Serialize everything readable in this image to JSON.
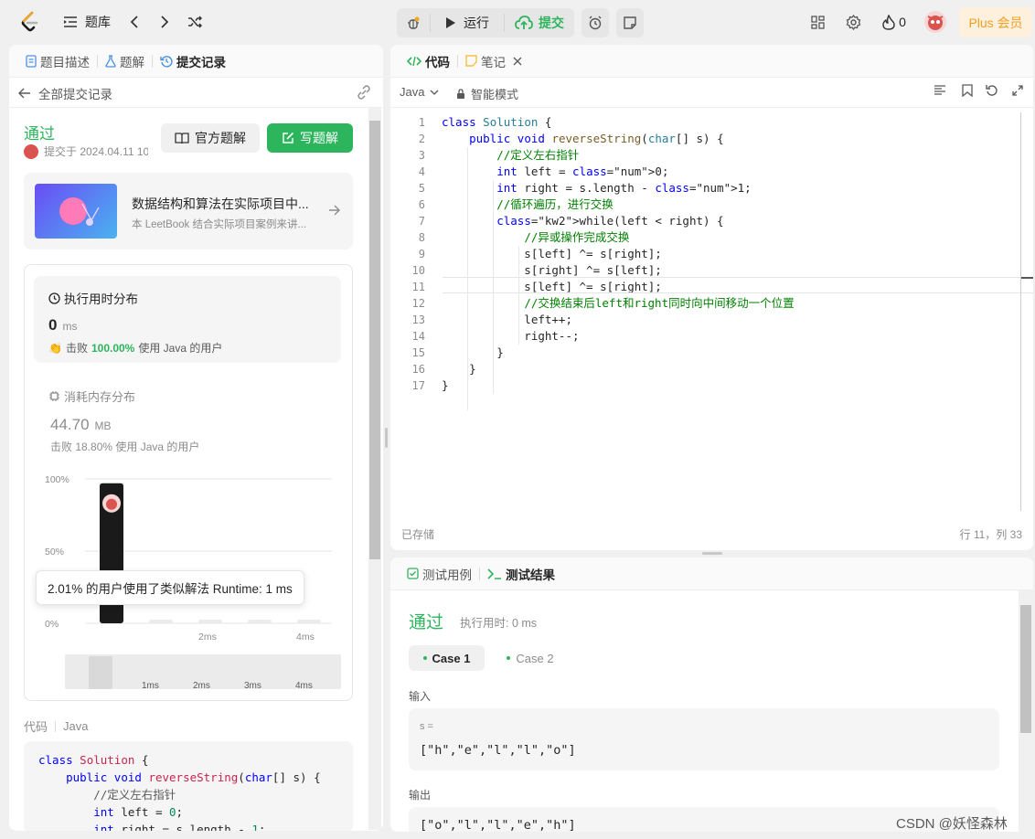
{
  "topbar": {
    "problems_label": "题库",
    "run_label": "运行",
    "submit_label": "提交",
    "streak_count": "0",
    "plus_label": "Plus 会员"
  },
  "left": {
    "tabs": [
      "题目描述",
      "题解",
      "提交记录"
    ],
    "back_label": "全部提交记录",
    "status": "通过",
    "submitted_at": "提交于 2024.04.11 10",
    "official_solution_label": "官方题解",
    "write_solution_label": "写题解",
    "promo": {
      "title": "数据结构和算法在实际项目中...",
      "subtitle": "本 LeetBook 结合实际项目案例来讲..."
    },
    "runtime": {
      "title": "执行用时分布",
      "value": "0",
      "unit": "ms",
      "beats_prefix": "击败",
      "beats_percent": "100.00%",
      "beats_suffix": "使用 Java 的用户"
    },
    "memory": {
      "title": "消耗内存分布",
      "value": "44.70",
      "unit": "MB",
      "beats_text": "击败 18.80% 使用 Java 的用户"
    },
    "tooltip": "2.01% 的用户使用了类似解法 Runtime: 1 ms",
    "code_label": "代码",
    "code_lang": "Java"
  },
  "chart_data": {
    "type": "bar",
    "categories": [
      "0ms",
      "1ms",
      "2ms",
      "3ms",
      "4ms"
    ],
    "values": [
      97,
      1,
      1,
      1,
      1
    ],
    "y_tick_labels": [
      "100%",
      "50%",
      "0%"
    ],
    "x_tick_labels": [
      "2ms",
      "4ms"
    ],
    "brush_tick_labels": [
      "1ms",
      "2ms",
      "3ms",
      "4ms"
    ],
    "ylim": [
      0,
      100
    ],
    "highlight_color": "#1a1a1a",
    "bar_color": "#ebebeb"
  },
  "code_panel": {
    "tab_code": "代码",
    "tab_notes": "笔记",
    "language": "Java",
    "mode": "智能模式",
    "saved_label": "已存储",
    "cursor_pos": "行 11，列 33"
  },
  "code_lines": [
    "class Solution {",
    "    public void reverseString(char[] s) {",
    "        //定义左右指针",
    "        int left = 0;",
    "        int right = s.length - 1;",
    "        //循环遍历，进行交换",
    "        while(left < right) {",
    "            //异或操作完成交换",
    "            s[left] ^= s[right];",
    "            s[right] ^= s[left];",
    "            s[left] ^= s[right];",
    "            //交换结束后left和right同时向中间移动一个位置",
    "            left++;",
    "            right--;",
    "        }",
    "    }",
    "}"
  ],
  "result": {
    "tab_testcase": "测试用例",
    "tab_result": "测试结果",
    "status": "通过",
    "runtime": "执行用时: 0 ms",
    "cases": [
      "Case 1",
      "Case 2"
    ],
    "input_label": "输入",
    "input_var": "s =",
    "input_value": "[\"h\",\"e\",\"l\",\"l\",\"o\"]",
    "output_label": "输出",
    "output_value": "[\"o\",\"l\",\"l\",\"e\",\"h\"]"
  },
  "watermark": "CSDN @妖怪森林"
}
